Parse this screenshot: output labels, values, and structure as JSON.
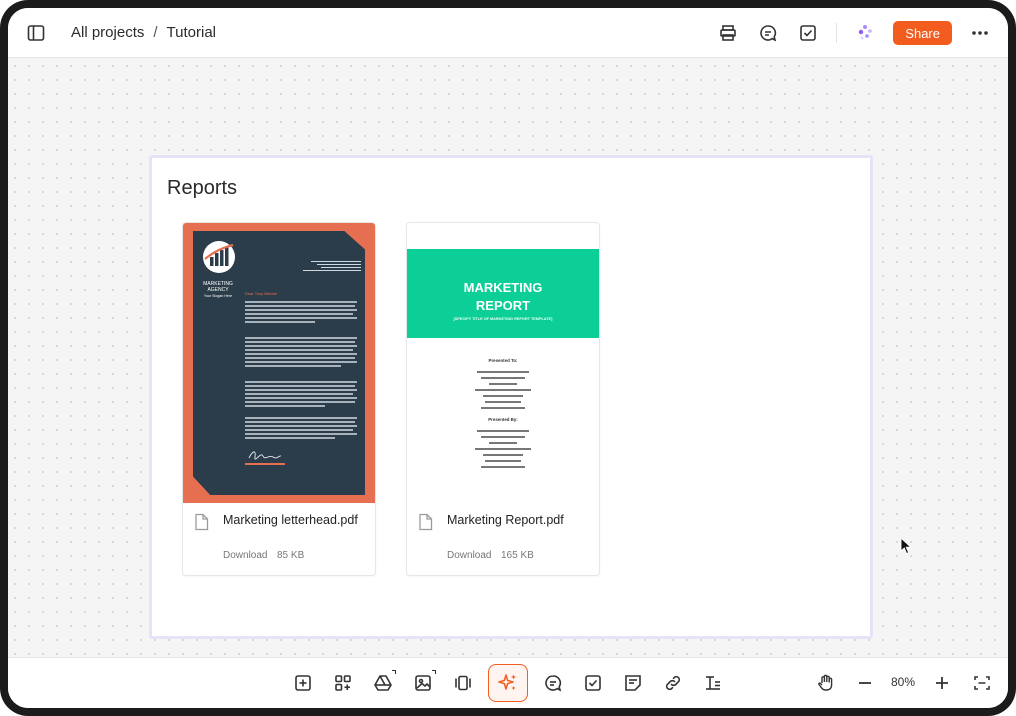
{
  "header": {
    "breadcrumb_root": "All projects",
    "breadcrumb_separator": "/",
    "breadcrumb_current": "Tutorial",
    "share_label": "Share"
  },
  "board": {
    "title": "Reports",
    "files": [
      {
        "name": "Marketing letterhead.pdf",
        "action": "Download",
        "size": "85 KB",
        "preview": {
          "brand_line1": "MARKETING",
          "brand_line2": "AGENCY",
          "brand_line3": "Your Slogan Here",
          "greeting": "Dear Tony Mitchel"
        }
      },
      {
        "name": "Marketing Report.pdf",
        "action": "Download",
        "size": "165 KB",
        "preview": {
          "title_line1": "MARKETING",
          "title_line2": "REPORT",
          "subtitle": "[SPECIFY TITLE OF MARKETING REPORT TEMPLATE]",
          "presented_to": "Presented To:",
          "presented_by": "Presented By:"
        }
      }
    ]
  },
  "toolbar": {
    "zoom": "80%"
  },
  "colors": {
    "accent": "#f25c1f",
    "report_green": "#0ccf97",
    "letterhead_orange": "#e66f52",
    "letterhead_dark": "#2b3d4a"
  }
}
